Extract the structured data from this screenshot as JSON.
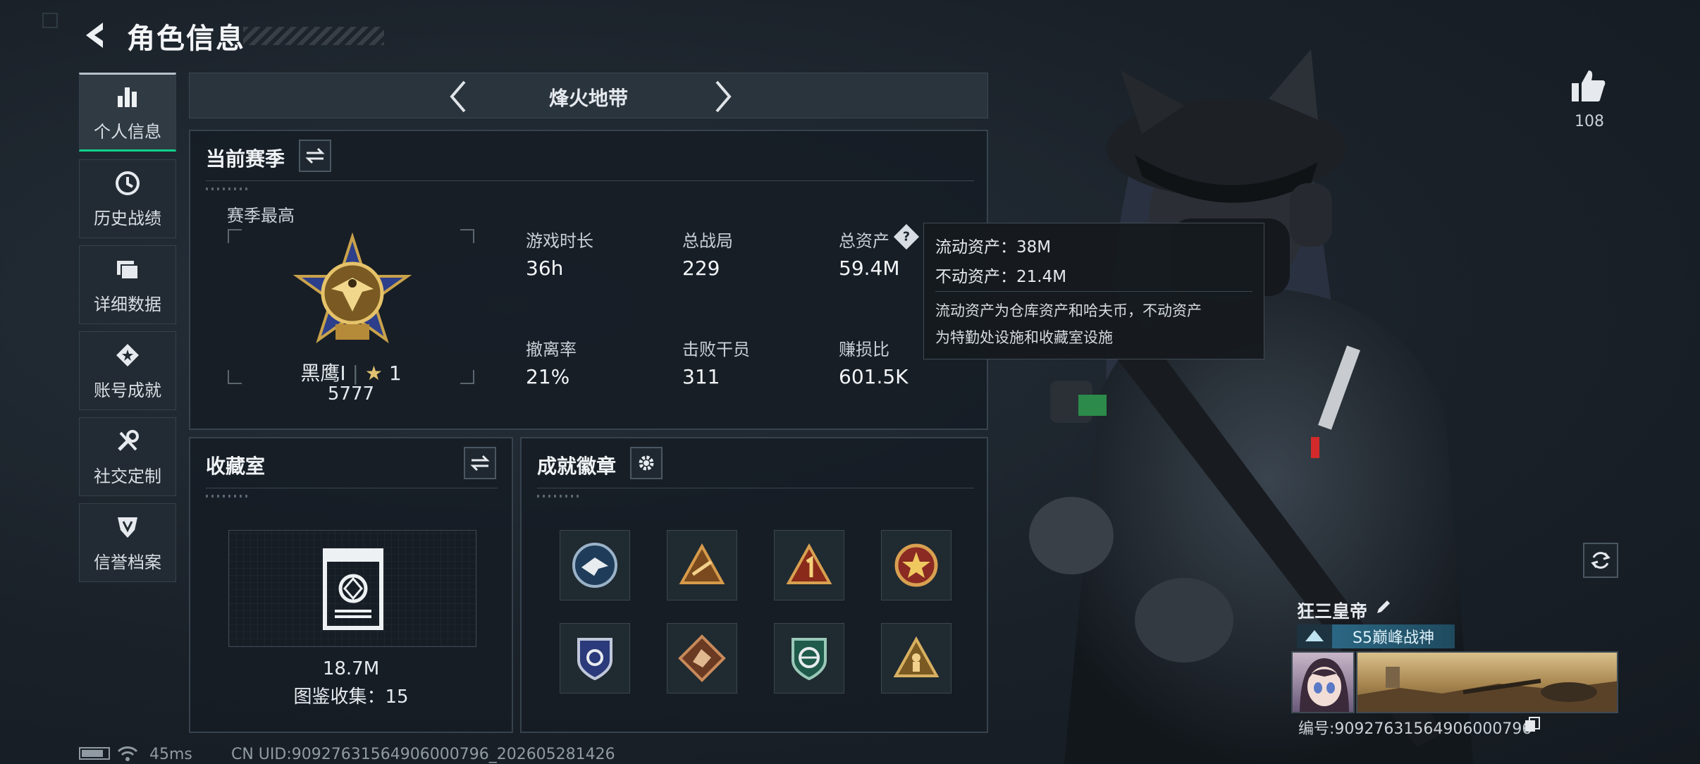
{
  "header": {
    "title": "角色信息"
  },
  "sidebar": {
    "items": [
      {
        "label": "个人信息",
        "icon": "bar-chart-icon"
      },
      {
        "label": "历史战绩",
        "icon": "history-icon"
      },
      {
        "label": "详细数据",
        "icon": "folder-icon"
      },
      {
        "label": "账号成就",
        "icon": "achievement-icon"
      },
      {
        "label": "社交定制",
        "icon": "wrench-icon"
      },
      {
        "label": "信誉档案",
        "icon": "shield-icon"
      }
    ]
  },
  "season_nav": {
    "name": "烽火地带"
  },
  "current_season": {
    "title": "当前赛季",
    "best_label": "赛季最高",
    "rank_name": "黑鹰I",
    "rank_stars": "1",
    "rank_score": "5777",
    "stats": [
      {
        "label": "游戏时长",
        "value": "36h"
      },
      {
        "label": "总战局",
        "value": "229"
      },
      {
        "label": "总资产",
        "value": "59.4M"
      },
      {
        "label": "撤离率",
        "value": "21%"
      },
      {
        "label": "击败干员",
        "value": "311"
      },
      {
        "label": "赚损比",
        "value": "601.5K"
      }
    ]
  },
  "tooltip": {
    "line1": "流动资产：38M",
    "line2": "不动资产：21.4M",
    "desc1": "流动资产为仓库资产和哈夫币，不动资产",
    "desc2": "为特勤处设施和收藏室设施"
  },
  "collection": {
    "title": "收藏室",
    "value": "18.7M",
    "collect_label": "图鉴收集：15"
  },
  "achievements": {
    "title": "成就徽章",
    "badges": [
      "eagle-badge-icon",
      "triangle-badge-icon",
      "number-one-badge-icon",
      "star-badge-icon",
      "shield-badge-icon",
      "dragon-badge-icon",
      "globe-badge-icon",
      "soldier-badge-icon"
    ]
  },
  "like": {
    "count": "108"
  },
  "player": {
    "name": "狂三皇帝",
    "title_badge": "S5巅峰战神",
    "id_text": "编号:9092763156490600079​6"
  },
  "status": {
    "ping": "45ms",
    "uid": "CN UID:9092763156490600079​6_202605281426"
  },
  "colors": {
    "accent": "#0fd18a",
    "panel_border": "#36434e",
    "title_badge": "#2e6f8e"
  }
}
